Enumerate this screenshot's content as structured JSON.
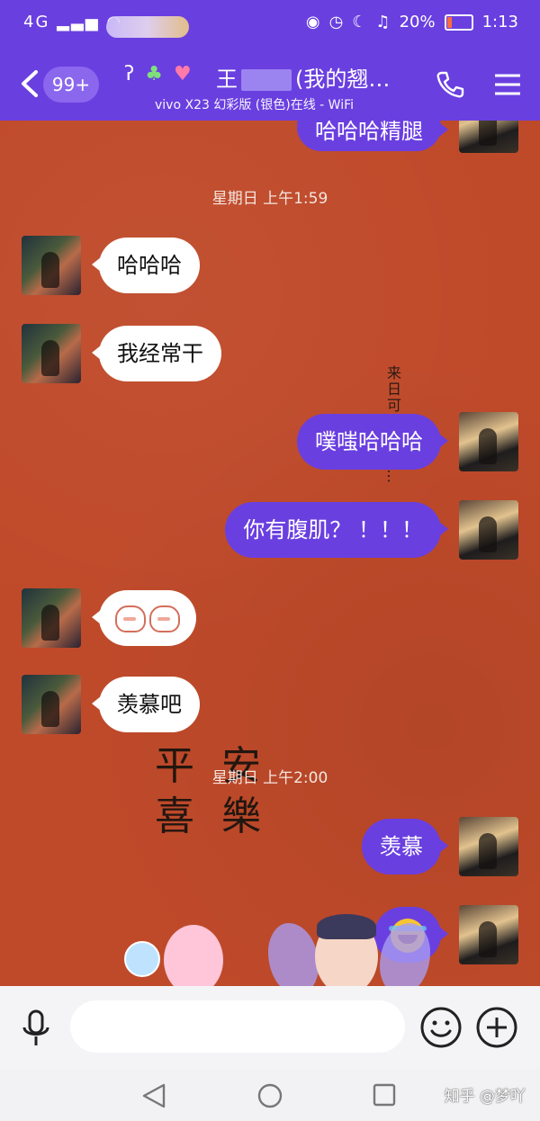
{
  "status_bar": {
    "network": "4G",
    "battery": "20%",
    "battery_level": 0.2,
    "time": "1:13"
  },
  "header": {
    "unread_badge": "99+",
    "contact_name_prefix": "王",
    "contact_name_suffix": "(我的翘…",
    "device_status": "vivo X23 幻彩版 (银色)在线 - WiFi"
  },
  "chat": {
    "wall_vertical_text": "来日可期 未年…",
    "wall_art": [
      "平 安",
      "喜 樂"
    ],
    "top_cut_bubble": "哈哈哈精腿",
    "timestamps": [
      "星期日 上午1:59",
      "星期日 上午2:00"
    ],
    "messages": [
      {
        "side": "in",
        "text": "哈哈哈"
      },
      {
        "side": "in",
        "text": "我经常干"
      },
      {
        "side": "out",
        "text": "噗嗤哈哈哈"
      },
      {
        "side": "out",
        "text": "你有腹肌？ ！！！"
      },
      {
        "side": "in",
        "text": "",
        "sticker": "two-faces-emoji"
      },
      {
        "side": "in",
        "text": "羡慕吧"
      },
      {
        "side": "out",
        "text": "羡慕"
      },
      {
        "side": "out",
        "text": "",
        "sticker": "laughing-crying-emoji"
      }
    ]
  },
  "input": {
    "placeholder": ""
  },
  "watermark": "知乎 @梦吖",
  "colors": {
    "accent": "#6a3fe0",
    "chat_background": "#bf4a2a",
    "incoming_bubble": "#ffffff",
    "outgoing_bubble": "#6a3fe0"
  }
}
